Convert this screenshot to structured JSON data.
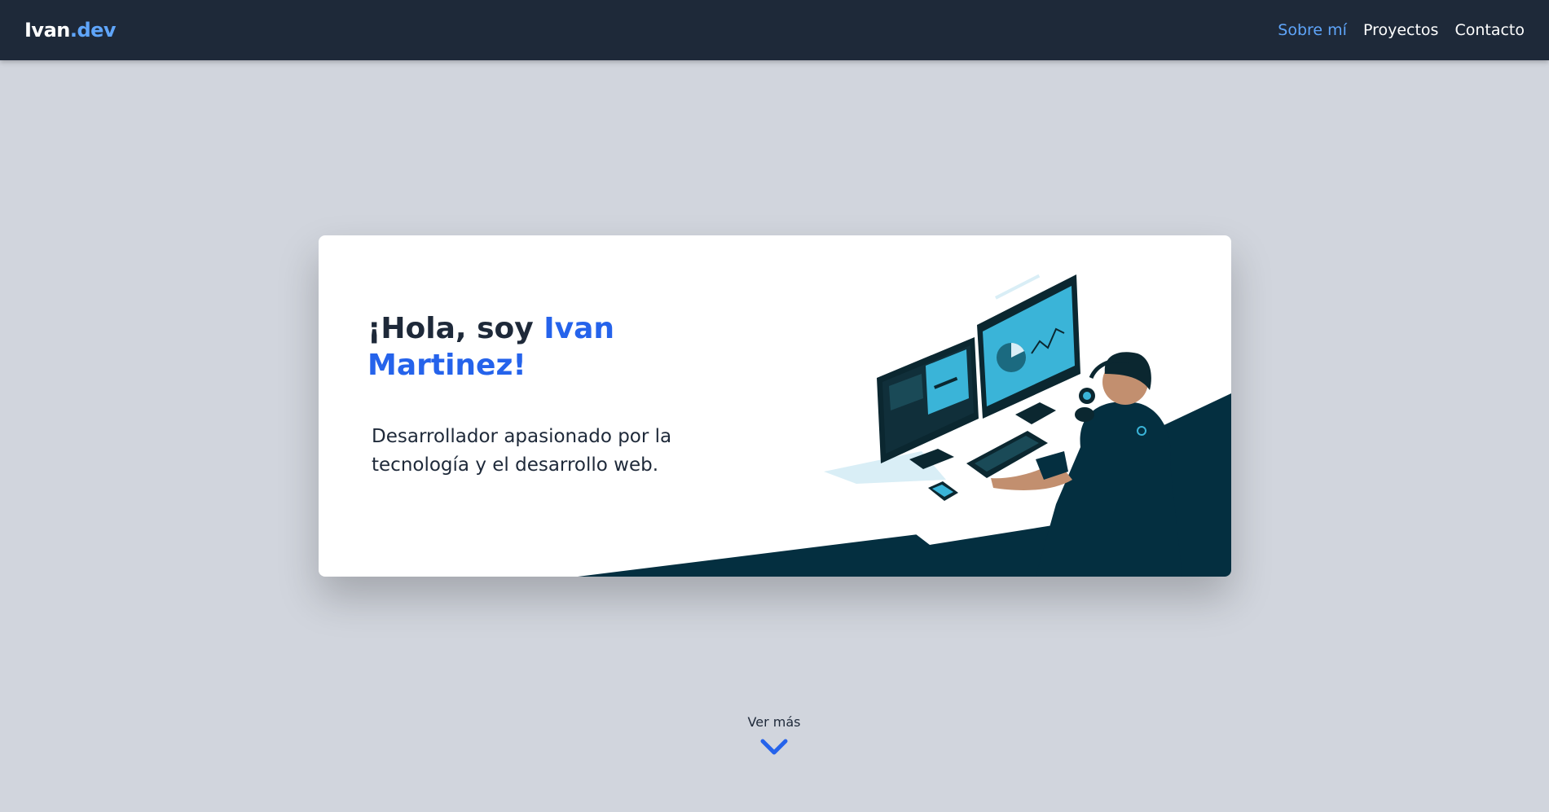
{
  "navbar": {
    "logo_main": "Ivan",
    "logo_accent": ".dev",
    "links": [
      {
        "label": "Sobre mí",
        "active": true
      },
      {
        "label": "Proyectos",
        "active": false
      },
      {
        "label": "Contacto",
        "active": false
      }
    ]
  },
  "hero": {
    "greeting": "¡Hola, soy ",
    "name": "Ivan Martinez!",
    "subtitle": "Desarrollador apasionado por la tecnología y el desarrollo web.",
    "illustration_icon": "developer-at-desk-illustration"
  },
  "scroll": {
    "label": "Ver más",
    "icon": "chevron-down-icon"
  },
  "colors": {
    "navbar_bg": "#1e2939",
    "accent": "#2563eb",
    "accent_light": "#5fa5fa",
    "page_bg": "#d1d5dd",
    "dark_teal": "#042f40"
  }
}
